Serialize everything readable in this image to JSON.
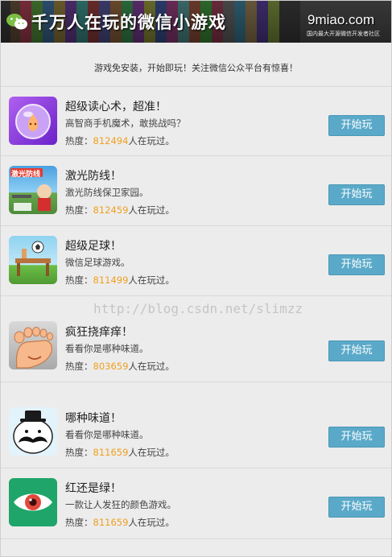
{
  "header": {
    "title": "千万人在玩的微信小游戏",
    "site": "9miao.com",
    "slogan": "国内最大开源微信开发者社区"
  },
  "notice": "游戏免安装，开始即玩！关注微信公众平台有惊喜！",
  "play_label": "开始玩",
  "heat_prefix": "热度：",
  "heat_suffix": "人在玩过。",
  "games": [
    {
      "name": "超级读心术，超准！",
      "desc": "高智商手机魔术，敢挑战吗？",
      "heat": "812494",
      "icon": "crystal-ball-icon"
    },
    {
      "name": "激光防线！",
      "desc": "激光防线保卫家园。",
      "heat": "812459",
      "icon": "laser-defense-icon",
      "icon_label": "激光防线"
    },
    {
      "name": "超级足球！",
      "desc": "微信足球游戏。",
      "heat": "811499",
      "icon": "soccer-ball-icon"
    },
    {
      "name": "疯狂挠痒痒！",
      "desc": "看看你是哪种味道。",
      "heat": "803659",
      "icon": "foot-icon"
    },
    {
      "name": "哪种味道！",
      "desc": "看看你是哪种味道。",
      "heat": "811659",
      "icon": "mustache-face-icon"
    },
    {
      "name": "红还是绿！",
      "desc": "一款让人发狂的颜色游戏。",
      "heat": "811659",
      "icon": "eye-icon"
    }
  ],
  "watermark": "http://blog.csdn.net/slimzz",
  "colors": {
    "button": "#5aa9c9",
    "heat_number": "#f0a020",
    "background": "#ececec"
  }
}
